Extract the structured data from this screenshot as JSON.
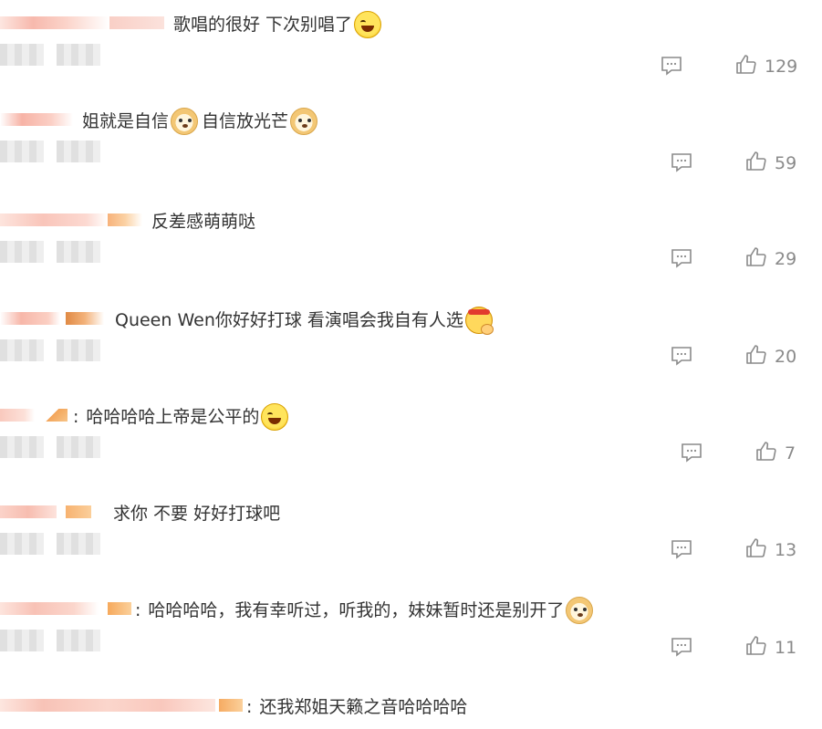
{
  "comments": [
    {
      "text": "歌唱的很好 下次别唱了",
      "emoji": "laugh-cry-emoji",
      "likes": "129"
    },
    {
      "text": "姐就是自信",
      "emoji": "doge-emoji",
      "text2": "自信放光芒",
      "emoji2": "doge-emoji",
      "likes": "59"
    },
    {
      "text": "反差感萌萌哒",
      "likes": "29"
    },
    {
      "text": "Queen Wen你好好打球 看演唱会我自有人选",
      "emoji": "fist-emoji",
      "likes": "20"
    },
    {
      "prefix": ":",
      "text": "哈哈哈哈上帝是公平的",
      "emoji": "laugh-emoji",
      "likes": "7"
    },
    {
      "text": "求你 不要 好好打球吧",
      "likes": "13"
    },
    {
      "prefix": ":",
      "text": "哈哈哈哈，我有幸听过，听我的，妹妹暂时还是别开了",
      "emoji": "doge-emoji",
      "likes": "11"
    },
    {
      "prefix": ":",
      "text": "还我郑姐天籁之音哈哈哈哈"
    }
  ],
  "colors": {
    "text": "#333333",
    "count": "#8a8a8a",
    "icon": "#8a8a8a",
    "blur": "#f6c3b8"
  }
}
